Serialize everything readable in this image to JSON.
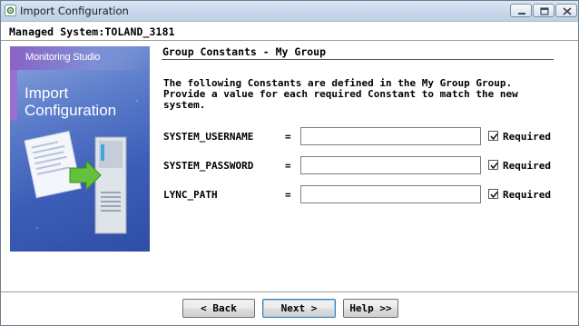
{
  "window": {
    "title": "Import Configuration",
    "icon": "app-gear-icon"
  },
  "header": {
    "managed_system": "Managed System:TOLAND_3181"
  },
  "side_image": {
    "brand": "Monitoring Studio",
    "title": "Import Configuration"
  },
  "panel": {
    "title": "Group Constants - My Group",
    "description": "The following Constants are defined in the My Group Group.\nProvide a value for each required Constant to match the new\nsystem."
  },
  "constants": [
    {
      "name": "SYSTEM_USERNAME",
      "equals": "=",
      "value": "",
      "required": true,
      "required_label": "Required"
    },
    {
      "name": "SYSTEM_PASSWORD",
      "equals": "=",
      "value": "",
      "required": true,
      "required_label": "Required"
    },
    {
      "name": "LYNC_PATH",
      "equals": "=",
      "value": "",
      "required": true,
      "required_label": "Required"
    }
  ],
  "buttons": {
    "back": "< Back",
    "next": "Next >",
    "help": "Help >>"
  }
}
